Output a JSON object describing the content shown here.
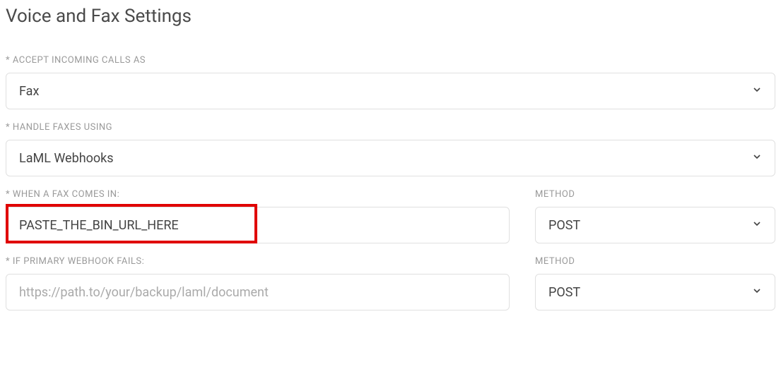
{
  "header": {
    "title": "Voice and Fax Settings"
  },
  "fields": {
    "accept_incoming": {
      "label": "* ACCEPT INCOMING CALLS AS",
      "value": "Fax"
    },
    "handle_faxes": {
      "label": "* HANDLE FAXES USING",
      "value": "LaML Webhooks"
    },
    "when_fax_comes": {
      "label": "* WHEN A FAX COMES IN:",
      "value": "PASTE_THE_BIN_URL_HERE"
    },
    "when_fax_method": {
      "label": "METHOD",
      "value": "POST"
    },
    "if_primary_fails": {
      "label": "* IF PRIMARY WEBHOOK FAILS:",
      "placeholder": "https://path.to/your/backup/laml/document",
      "value": ""
    },
    "if_primary_method": {
      "label": "METHOD",
      "value": "POST"
    }
  }
}
